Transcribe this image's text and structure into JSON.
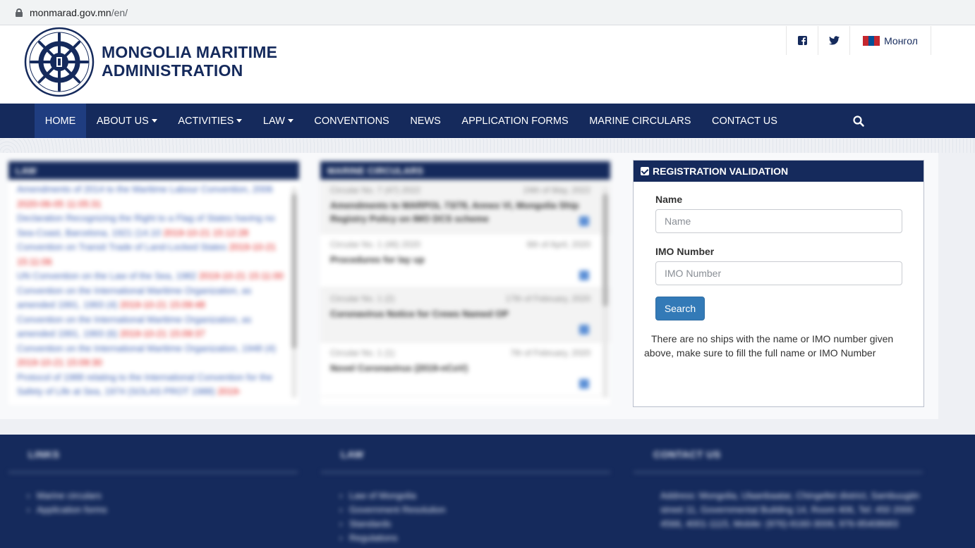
{
  "browser": {
    "url_host": "monmarad.gov.mn",
    "url_path": "/en/"
  },
  "header": {
    "title_line1": "MONGOLIA MARITIME",
    "title_line2": "ADMINISTRATION",
    "language_label": "Монгол"
  },
  "nav": {
    "items": [
      {
        "label": "HOME",
        "active": true,
        "dropdown": false
      },
      {
        "label": "ABOUT US",
        "dropdown": true
      },
      {
        "label": "ACTIVITIES",
        "dropdown": true
      },
      {
        "label": "LAW",
        "dropdown": true
      },
      {
        "label": "CONVENTIONS",
        "dropdown": false
      },
      {
        "label": "NEWS",
        "dropdown": false
      },
      {
        "label": "APPLICATION FORMS",
        "dropdown": false
      },
      {
        "label": "MARINE CIRCULARS",
        "dropdown": false
      },
      {
        "label": "CONTACT US",
        "dropdown": false
      }
    ]
  },
  "law_panel": {
    "title": "LAW",
    "entries": [
      {
        "text": "Amendments of 2014 to the Maritime Labour Convention, 2006",
        "date": "2020-06-05 11:05:31"
      },
      {
        "text": "Declaration Recognizing the Right to a Flag of States having no Sea-Coast, Barcelona, 1921 (14.10",
        "date": "2019-10-21 15:12:28"
      },
      {
        "text": "Convention on Transit Trade of Land-Locked States",
        "date": "2019-10-21 15:11:06"
      },
      {
        "text": "UN Convention on the Law of the Sea, 1982",
        "date": "2019-10-21 15:11:00"
      },
      {
        "text": "Convention on the International Maritime Organization, as amended 1991, 1993 (4)",
        "date": "2019-10-21 15:09:48"
      },
      {
        "text": "Convention on the International Maritime Organization, as amended 1991, 1993 (6)",
        "date": "2019-10-21 15:09:37"
      },
      {
        "text": "Convention on the International Maritime Organization, 1948 (4)",
        "date": "2019-10-21 15:09:30"
      },
      {
        "text": "Protocol of 1988 relating to the International Convention for the Safety of Life at Sea, 1974 (SOLAS PROT 1988)",
        "date": "2019-"
      }
    ]
  },
  "circulars_panel": {
    "title": "MARINE CIRCULARS",
    "items": [
      {
        "number": "Circular No. 7 (47) 2022",
        "date": "24th of May, 2022",
        "title": "Amendments to MARPOL 73/78, Annex VI, Mongolia Ship Registry Policy on IMO DCS scheme"
      },
      {
        "number": "Circular No. 1 (46) 2020",
        "date": "6th of April, 2020",
        "title": "Procedures for lay up"
      },
      {
        "number": "Circular No. 1 (2)",
        "date": "17th of February, 2020",
        "title": "Coronavirus Notice for Crews Named OP"
      },
      {
        "number": "Circular No. 1 (1)",
        "date": "7th of February, 2020",
        "title": "Novel Coronavirus (2019-nCoV)"
      }
    ]
  },
  "registration": {
    "title": "REGISTRATION VALIDATION",
    "name_label": "Name",
    "name_placeholder": "Name",
    "imo_label": "IMO Number",
    "imo_placeholder": "IMO Number",
    "search_label": "Search",
    "message": "There are no ships with the name or IMO number given above, make sure to fill the full name or IMO Number"
  },
  "footer": {
    "links_title": "LINKS",
    "links": [
      "Marine circulars",
      "Application forms"
    ],
    "law_title": "LAW",
    "law_links": [
      "Law of Mongolia",
      "Government Resolution",
      "Standards",
      "Regulations"
    ],
    "contact_title": "CONTACT US",
    "contact_text": "Address: Mongolia, Ulaanbaatar, Chingeltei district, Sambuugiin street 11, Governmental Building 14, Room 406, Tel: 450 2000 4566, 4001-1115, Mobile: (976)-9160-3006, 976-95408683"
  },
  "colors": {
    "navy": "#152a5c",
    "nav_active": "#1f3d80",
    "button_blue": "#337ab7",
    "law_link": "#3f63b5",
    "law_date": "#e02020"
  }
}
